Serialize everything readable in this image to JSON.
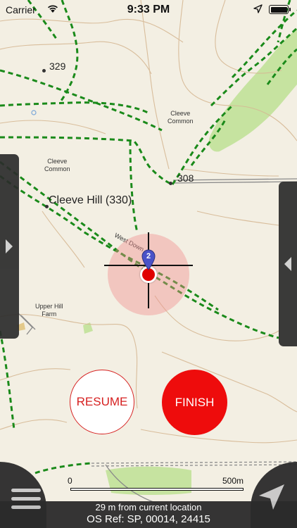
{
  "status_bar": {
    "carrier": "Carrier",
    "time": "9:33 PM",
    "icons": [
      "wifi-icon",
      "location-arrow-icon",
      "battery-icon"
    ]
  },
  "map": {
    "labels": {
      "spot_329": "329",
      "cleeve_common_ne_line1": "Cleeve",
      "cleeve_common_ne_line2": "Common",
      "cleeve_common_w_line1": "Cleeve",
      "cleeve_common_w_line2": "Common",
      "spot_308": "308",
      "cleeve_hill": "Cleeve Hill (330)",
      "west_down": "West Down",
      "upper_hill_farm_line1": "Upper Hill",
      "upper_hill_farm_line2": "Farm"
    },
    "colors": {
      "background": "#f3efe3",
      "contour": "#d2b08a",
      "path": "#1a8a1a",
      "woodland": "#c6e3a0",
      "road": "#8a8a8a"
    }
  },
  "location": {
    "waypoint_number": "2",
    "icons": [
      "crosshair-icon",
      "waypoint-pin-icon",
      "current-location-dot"
    ]
  },
  "controls": {
    "resume_label": "RESUME",
    "finish_label": "FINISH",
    "left_tab_icon": "chevron-right-icon",
    "right_tab_icon": "chevron-left-icon",
    "menu_icon": "hamburger-menu-icon",
    "navigate_icon": "navigation-arrow-icon"
  },
  "scale": {
    "min_label": "0",
    "max_label": "500m"
  },
  "footer": {
    "distance_text": "29 m from current location",
    "os_ref": "OS Ref: SP, 00014, 24415"
  },
  "accent_colors": {
    "finish_button": "#ee0c0c",
    "resume_button_border": "#d62020",
    "panel": "#2b2b2b"
  }
}
